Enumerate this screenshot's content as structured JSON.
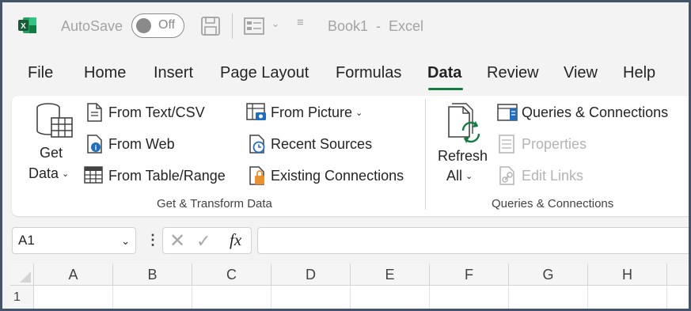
{
  "titlebar": {
    "app_icon": "excel-logo-icon",
    "autosave_label": "AutoSave",
    "autosave_state": "Off",
    "title": "Book1  -  Excel",
    "brand_color": "#107c41"
  },
  "tabs": [
    {
      "label": "File",
      "active": false
    },
    {
      "label": "Home",
      "active": false
    },
    {
      "label": "Insert",
      "active": false
    },
    {
      "label": "Page Layout",
      "active": false
    },
    {
      "label": "Formulas",
      "active": false
    },
    {
      "label": "Data",
      "active": true
    },
    {
      "label": "Review",
      "active": false
    },
    {
      "label": "View",
      "active": false
    },
    {
      "label": "Help",
      "active": false
    }
  ],
  "ribbon": {
    "get_transform": {
      "get_data_line1": "Get",
      "get_data_line2": "Data",
      "from_text_csv": "From Text/CSV",
      "from_web": "From Web",
      "from_table_range": "From Table/Range",
      "from_picture": "From Picture",
      "recent_sources": "Recent Sources",
      "existing_connections": "Existing Connections",
      "group_label": "Get & Transform Data"
    },
    "queries": {
      "refresh_line1": "Refresh",
      "refresh_line2": "All",
      "queries_connections": "Queries & Connections",
      "properties": "Properties",
      "edit_links": "Edit Links",
      "group_label": "Queries & Connections"
    }
  },
  "formula_bar": {
    "name_box": "A1",
    "formula": ""
  },
  "grid": {
    "columns": [
      "A",
      "B",
      "C",
      "D",
      "E",
      "F",
      "G",
      "H"
    ],
    "rows": [
      "1"
    ]
  }
}
